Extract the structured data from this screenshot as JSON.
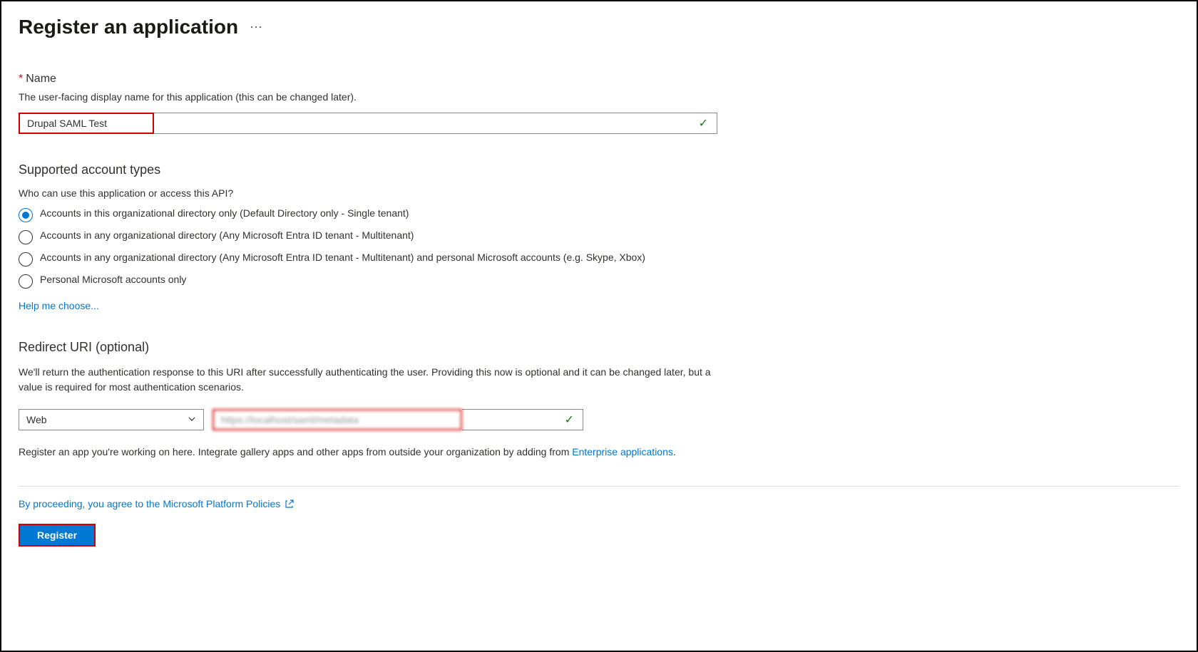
{
  "header": {
    "title": "Register an application"
  },
  "nameField": {
    "label": "Name",
    "description": "The user-facing display name for this application (this can be changed later).",
    "value": "Drupal SAML Test"
  },
  "accountTypes": {
    "title": "Supported account types",
    "question": "Who can use this application or access this API?",
    "options": [
      {
        "label": "Accounts in this organizational directory only (Default Directory only - Single tenant)",
        "selected": true
      },
      {
        "label": "Accounts in any organizational directory (Any Microsoft Entra ID tenant - Multitenant)",
        "selected": false
      },
      {
        "label": "Accounts in any organizational directory (Any Microsoft Entra ID tenant - Multitenant) and personal Microsoft accounts (e.g. Skype, Xbox)",
        "selected": false
      },
      {
        "label": "Personal Microsoft accounts only",
        "selected": false
      }
    ],
    "helpLink": "Help me choose..."
  },
  "redirect": {
    "title": "Redirect URI (optional)",
    "description": "We'll return the authentication response to this URI after successfully authenticating the user. Providing this now is optional and it can be changed later, but a value is required for most authentication scenarios.",
    "platformSelected": "Web",
    "uriValue": "https://localhost/saml/metadata"
  },
  "footer": {
    "prefix": "Register an app you're working on here. Integrate gallery apps and other apps from outside your organization by adding from ",
    "linkText": "Enterprise applications",
    "suffix": ".",
    "policyText": "By proceeding, you agree to the Microsoft Platform Policies",
    "registerLabel": "Register"
  }
}
